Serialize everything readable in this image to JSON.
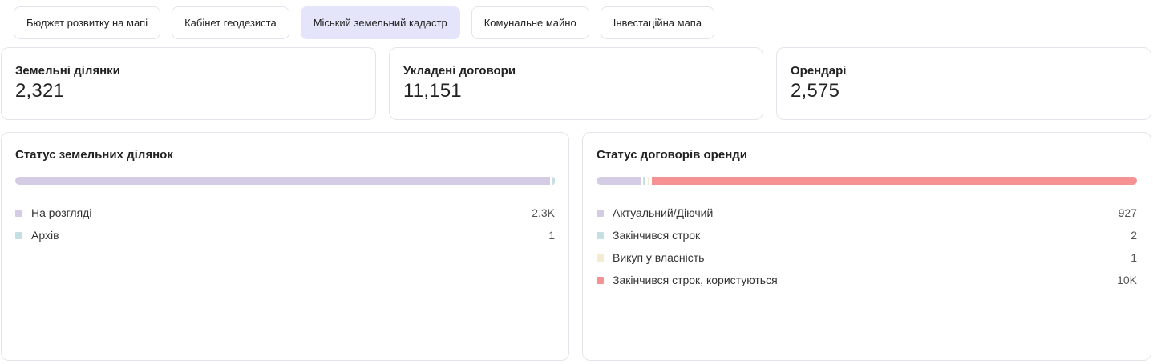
{
  "tabs": [
    {
      "label": "Бюджет розвитку на мапі",
      "active": false
    },
    {
      "label": "Кабінет геодезиста",
      "active": false
    },
    {
      "label": "Міський земельний кадастр",
      "active": true
    },
    {
      "label": "Комунальне майно",
      "active": false
    },
    {
      "label": "Інвестаційна мапа",
      "active": false
    }
  ],
  "kpis": [
    {
      "label": "Земельні ділянки",
      "value": "2,321"
    },
    {
      "label": "Укладені договори",
      "value": "11,151"
    },
    {
      "label": "Орендарі",
      "value": "2,575"
    }
  ],
  "panels": [
    {
      "title": "Статус земельних ділянок",
      "items": [
        {
          "label": "На розгляді",
          "value": "2.3K",
          "count": 2320,
          "color": "#d4cbe5"
        },
        {
          "label": "Архів",
          "value": "1",
          "count": 1,
          "color": "#c5dfe3"
        }
      ]
    },
    {
      "title": "Статус договорів оренди",
      "items": [
        {
          "label": "Актуальний/Діючий",
          "value": "927",
          "count": 927,
          "color": "#d4cbe5"
        },
        {
          "label": "Закінчився строк",
          "value": "2",
          "count": 2,
          "color": "#c5dfe3"
        },
        {
          "label": "Викуп у власність",
          "value": "1",
          "count": 1,
          "color": "#f3ecd3"
        },
        {
          "label": "Закінчився строк, користуються",
          "value": "10K",
          "count": 10221,
          "color": "#f79294"
        }
      ]
    }
  ]
}
